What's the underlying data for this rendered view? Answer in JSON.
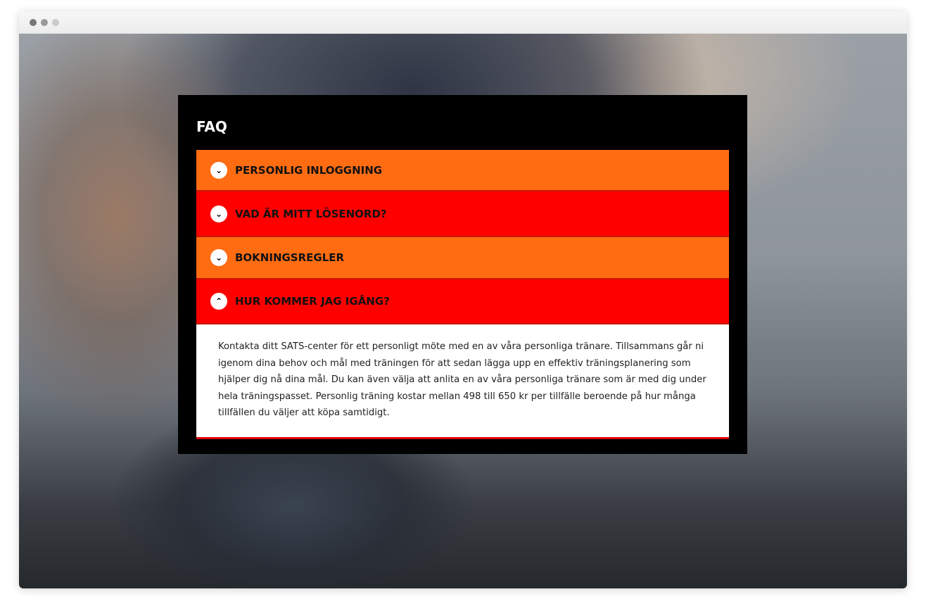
{
  "faq": {
    "title": "FAQ",
    "items": [
      {
        "label": "PERSONLIG INLOGGNING",
        "icon": "chevron-down-icon",
        "color": "#ff6c12",
        "expanded": false
      },
      {
        "label": "VAD ÄR MITT LÖSENORD?",
        "icon": "chevron-down-icon",
        "color": "#ff0000",
        "expanded": false
      },
      {
        "label": "BOKNINGSREGLER",
        "icon": "chevron-down-icon",
        "color": "#ff6c12",
        "expanded": false
      },
      {
        "label": "HUR KOMMER JAG IGÅNG?",
        "icon": "chevron-up-icon",
        "color": "#ff0000",
        "expanded": true
      }
    ],
    "answer": "Kontakta ditt SATS-center för ett personligt möte med en av våra personliga tränare. Tillsammans går ni igenom dina behov och mål med träningen för att sedan lägga upp en effektiv träningsplanering som hjälper dig nå dina mål. Du kan även välja att anlita en av våra personliga tränare som är med dig under hela träningspasset. Personlig träning kostar mellan 498 till 650 kr per tillfälle beroende på hur många tillfällen du väljer att köpa samtidigt."
  }
}
